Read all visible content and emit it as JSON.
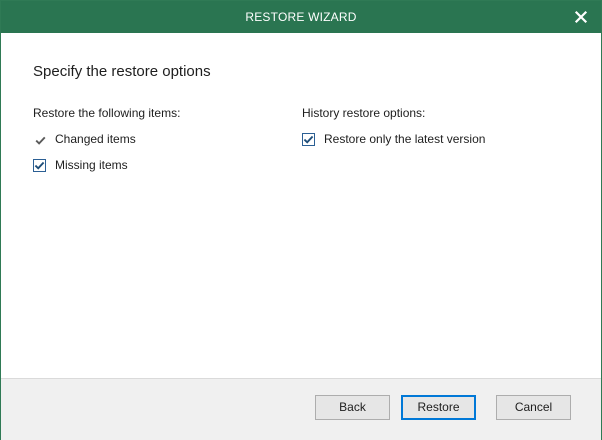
{
  "window": {
    "title": "RESTORE WIZARD",
    "close_icon": "close-icon",
    "accent_color": "#2a7551"
  },
  "main": {
    "heading": "Specify the restore options",
    "restore_items": {
      "label": "Restore the following items:",
      "options": [
        {
          "label": "Changed items",
          "checked": true
        },
        {
          "label": "Missing items",
          "checked": true
        }
      ]
    },
    "history": {
      "label": "History restore options:",
      "options": [
        {
          "label": "Restore only the latest version",
          "checked": true
        }
      ]
    }
  },
  "footer": {
    "back_label": "Back",
    "restore_label": "Restore",
    "cancel_label": "Cancel"
  }
}
